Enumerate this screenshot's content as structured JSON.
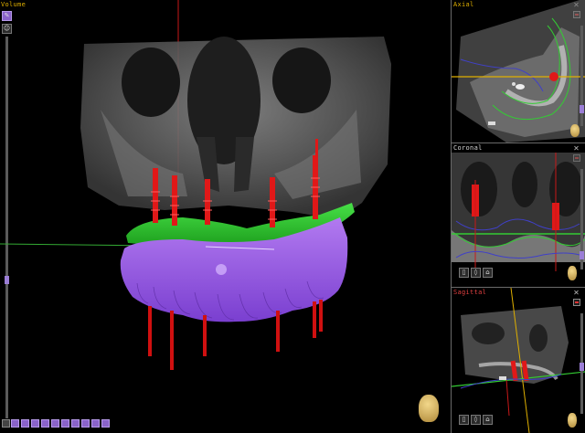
{
  "volume_panel": {
    "title": "Volume"
  },
  "axial_panel": {
    "title": "Axial"
  },
  "coronal_panel": {
    "title": "Coronal"
  },
  "sagittal_panel": {
    "title": "Sagittal"
  },
  "colors": {
    "volume_title": "#e0b000",
    "axial_title": "#e0b000",
    "coronal_title": "#d8d8d8",
    "sagittal_title": "#e04040",
    "implant": "#e01818",
    "gingiva": "#2fc92f",
    "teeth": "#9a55e6",
    "accent": "#8a63c9"
  },
  "icons": {
    "volume_tools": [
      "paint-icon",
      "head-icon"
    ],
    "bottom_toolbar": [
      "screenshot-icon",
      "grid-icon",
      "layer-icon",
      "tooth-icon",
      "implant-icon",
      "ruler-icon",
      "arrow-icon",
      "cut-icon",
      "measure-icon",
      "nerve-icon",
      "settings-icon"
    ],
    "view_tools": [
      "tooth-view-icon",
      "implant-view-icon",
      "crown-view-icon"
    ],
    "orientation": "head-orientation-icon"
  }
}
